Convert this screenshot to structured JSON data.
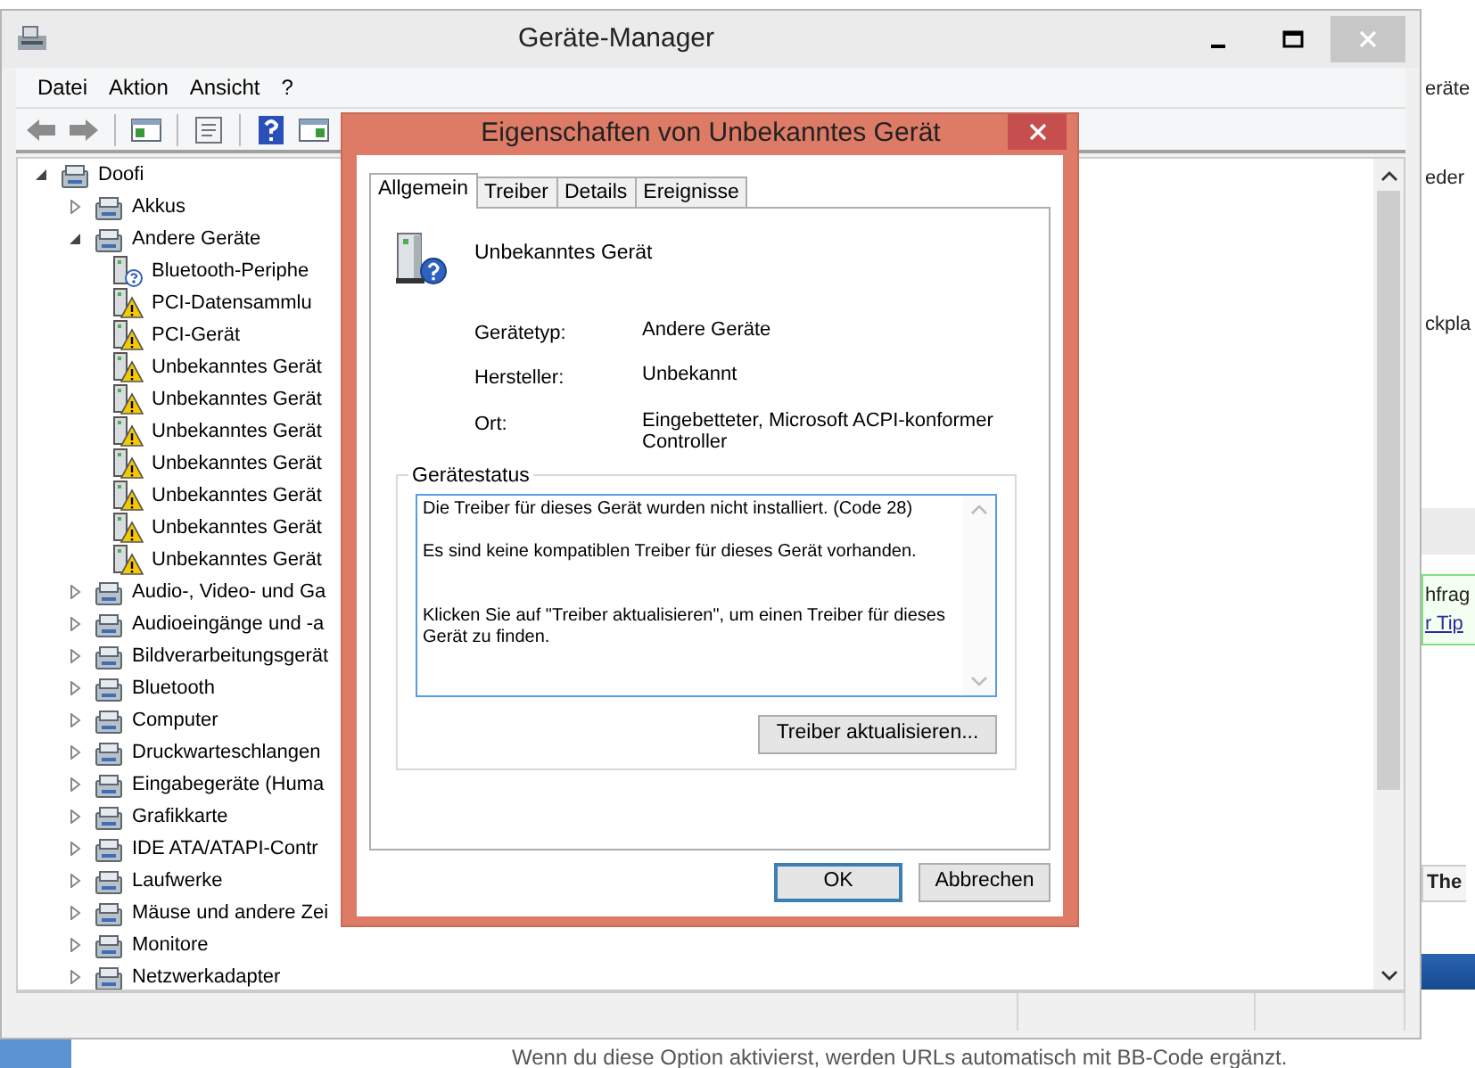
{
  "background_page": {
    "texts": [
      "eräte",
      "eder",
      "ckpla",
      "hfrag"
    ],
    "link": "r Tip",
    "tab_label": "The",
    "footer_note": "Wenn du diese Option aktivierst, werden URLs automatisch mit BB-Code ergänzt."
  },
  "device_manager": {
    "title": "Geräte-Manager",
    "menu": [
      "Datei",
      "Aktion",
      "Ansicht",
      "?"
    ],
    "tree": [
      {
        "label": "Doofi",
        "expanded": true,
        "children": [
          {
            "label": "Akkus",
            "expanded": false
          },
          {
            "label": "Andere Geräte",
            "expanded": true,
            "children": [
              {
                "label": "Bluetooth-Periphe",
                "warning": false
              },
              {
                "label": "PCI-Datensammlu",
                "warning": true
              },
              {
                "label": "PCI-Gerät",
                "warning": true
              },
              {
                "label": "Unbekanntes Gerät",
                "warning": true
              },
              {
                "label": "Unbekanntes Gerät",
                "warning": true
              },
              {
                "label": "Unbekanntes Gerät",
                "warning": true
              },
              {
                "label": "Unbekanntes Gerät",
                "warning": true
              },
              {
                "label": "Unbekanntes Gerät",
                "warning": true
              },
              {
                "label": "Unbekanntes Gerät",
                "warning": true
              },
              {
                "label": "Unbekanntes Gerät",
                "warning": true
              }
            ]
          },
          {
            "label": "Audio-, Video- und Ga",
            "expanded": false
          },
          {
            "label": "Audioeingänge und -a",
            "expanded": false
          },
          {
            "label": "Bildverarbeitungsgerät",
            "expanded": false
          },
          {
            "label": "Bluetooth",
            "expanded": false
          },
          {
            "label": "Computer",
            "expanded": false
          },
          {
            "label": "Druckwarteschlangen",
            "expanded": false
          },
          {
            "label": "Eingabegeräte (Huma",
            "expanded": false
          },
          {
            "label": "Grafikkarte",
            "expanded": false
          },
          {
            "label": "IDE ATA/ATAPI-Contr",
            "expanded": false
          },
          {
            "label": "Laufwerke",
            "expanded": false
          },
          {
            "label": "Mäuse und andere Zei",
            "expanded": false
          },
          {
            "label": "Monitore",
            "expanded": false
          },
          {
            "label": "Netzwerkadapter",
            "expanded": false
          }
        ]
      }
    ]
  },
  "dialog": {
    "title": "Eigenschaften von Unbekanntes Gerät",
    "tabs": [
      {
        "label": "Allgemein",
        "selected": true
      },
      {
        "label": "Treiber",
        "selected": false
      },
      {
        "label": "Details",
        "selected": false
      },
      {
        "label": "Ereignisse",
        "selected": false
      }
    ],
    "device_name": "Unbekanntes Gerät",
    "properties": [
      {
        "label": "Gerätetyp:",
        "value": "Andere Geräte"
      },
      {
        "label": "Hersteller:",
        "value": "Unbekannt"
      },
      {
        "label": "Ort:",
        "value": "Eingebetteter, Microsoft ACPI-konformer Controller"
      }
    ],
    "status_group": {
      "title": "Gerätestatus",
      "text": "Die Treiber für dieses Gerät wurden nicht installiert. (Code 28)\n\nEs sind keine kompatiblen Treiber für dieses Gerät vorhanden.\n\n\nKlicken Sie auf \"Treiber aktualisieren\", um einen Treiber für dieses Gerät zu finden.",
      "button": "Treiber aktualisieren..."
    },
    "buttons": [
      {
        "label": "OK",
        "default": true
      },
      {
        "label": "Abbrechen",
        "default": false
      }
    ]
  }
}
